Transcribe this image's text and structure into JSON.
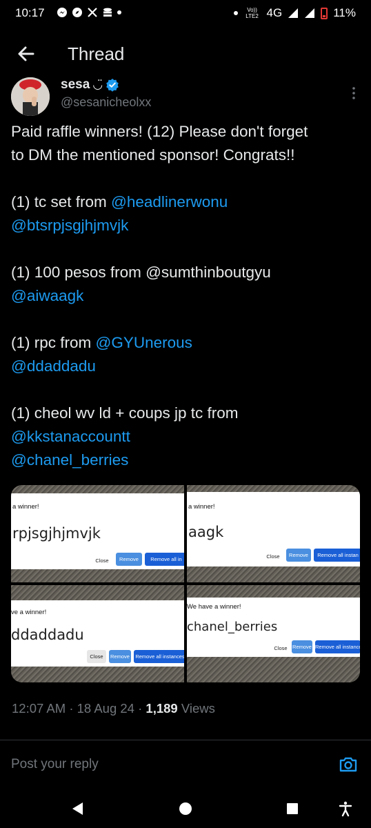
{
  "status_bar": {
    "time": "10:17",
    "network": "4G",
    "volte": "Vo)) LTE2",
    "battery": "11%"
  },
  "header": {
    "title": "Thread"
  },
  "author": {
    "name": "sesa",
    "name_emoji": "◡̈",
    "handle": "@sesanicheolxx"
  },
  "tweet": {
    "lines": [
      {
        "text": "Paid raffle winners! (12) Please don't forget"
      },
      {
        "text": "to DM the mentioned sponsor! Congrats!!"
      },
      {
        "text": ""
      },
      {
        "prefix": "(1) tc set from ",
        "mention": "@headlinerwonu"
      },
      {
        "mention": "@btsrpjsgjhjmvjk"
      },
      {
        "text": ""
      },
      {
        "text": "(1) 100 pesos from @sumthinboutgyu"
      },
      {
        "mention": "@aiwaagk"
      },
      {
        "text": ""
      },
      {
        "prefix": "(1) rpc from ",
        "mention": "@GYUnerous"
      },
      {
        "mention": "@ddaddadu"
      },
      {
        "text": ""
      },
      {
        "text": "(1) cheol wv ld + coups jp tc from"
      },
      {
        "mention": "@kkstanaccountt"
      },
      {
        "mention": "@chanel_berries"
      }
    ]
  },
  "media": [
    {
      "title": "a winner!",
      "name": "rpjsgjhjmvjk",
      "close": "Close",
      "remove": "Remove",
      "remove_all": "Remove all in"
    },
    {
      "title": "a winner!",
      "name": "aagk",
      "close": "Close",
      "remove": "Remove",
      "remove_all": "Remove all instan"
    },
    {
      "title": "ve a winner!",
      "name": "ddaddadu",
      "close": "Close",
      "remove": "Remove",
      "remove_all": "Remove all instances"
    },
    {
      "title": "We have a winner!",
      "name": "chanel_berries",
      "close": "Close",
      "remove": "Remove",
      "remove_all": "Remove all instance"
    }
  ],
  "meta": {
    "time": "12:07 AM",
    "date": "18 Aug 24",
    "views_count": "1,189",
    "views_label": "Views",
    "sep": "·"
  },
  "reply": {
    "placeholder": "Post your reply"
  },
  "colors": {
    "accent": "#1d9bf0",
    "verified": "#1d9bf0",
    "background": "#000000"
  },
  "icons": [
    "back-arrow-icon",
    "verified-badge-icon",
    "more-vertical-icon",
    "camera-icon",
    "nav-back-icon",
    "nav-home-icon",
    "nav-recents-icon",
    "accessibility-icon"
  ]
}
